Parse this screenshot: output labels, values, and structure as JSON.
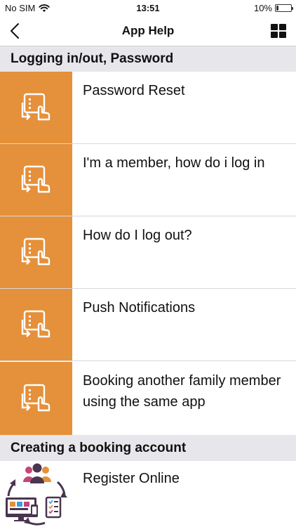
{
  "status_bar": {
    "carrier": "No SIM",
    "time": "13:51",
    "battery": "10%"
  },
  "nav": {
    "title": "App Help"
  },
  "sections": [
    {
      "title": "Logging in/out, Password",
      "items": [
        {
          "label": "Password Reset"
        },
        {
          "label": "I'm a member, how do i log in"
        },
        {
          "label": "How do I log out?"
        },
        {
          "label": "Push Notifications"
        },
        {
          "label": "Booking another family member using the same app"
        }
      ]
    },
    {
      "title": "Creating a booking account",
      "items": [
        {
          "label": "Register Online"
        }
      ]
    }
  ],
  "colors": {
    "accent": "#e5903a",
    "section_bg": "#e6e6eb",
    "purple": "#4a3550"
  },
  "icons": {
    "tablet": "tablet-tap-icon",
    "register": "register-cycle-icon"
  }
}
